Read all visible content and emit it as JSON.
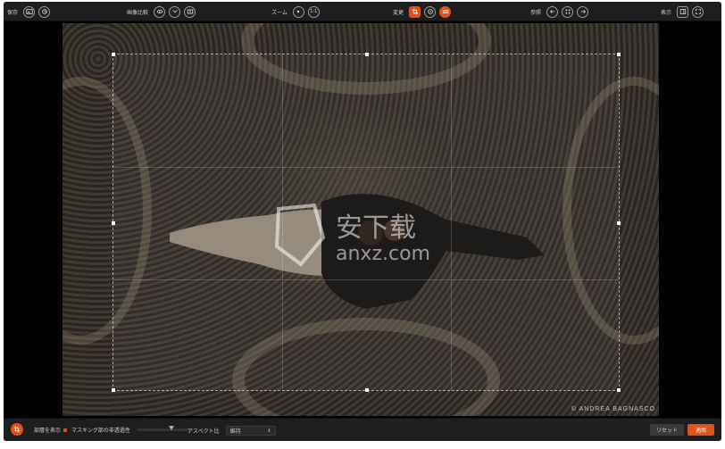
{
  "toolbar": {
    "save_label": "保存",
    "compare_label": "画像比較",
    "zoom_label": "ズーム",
    "zoom_value": "1:1",
    "edit_label": "変更",
    "reference_label": "参照",
    "view_label": "表示"
  },
  "photo": {
    "credit": "© ANDREA BAGNASCO",
    "watermark_cn": "安下载",
    "watermark_url": "anxz.com"
  },
  "bottombar": {
    "show_outside_label": "部層を表示",
    "masking_opacity_label": "マスキング部の非透過性",
    "masking_opacity": 0.6,
    "aspect_label": "アスペクト比",
    "aspect_value": "維持",
    "reset_label": "リセット",
    "apply_label": "適用"
  },
  "colors": {
    "accent": "#e0521c",
    "background": "#161616"
  }
}
